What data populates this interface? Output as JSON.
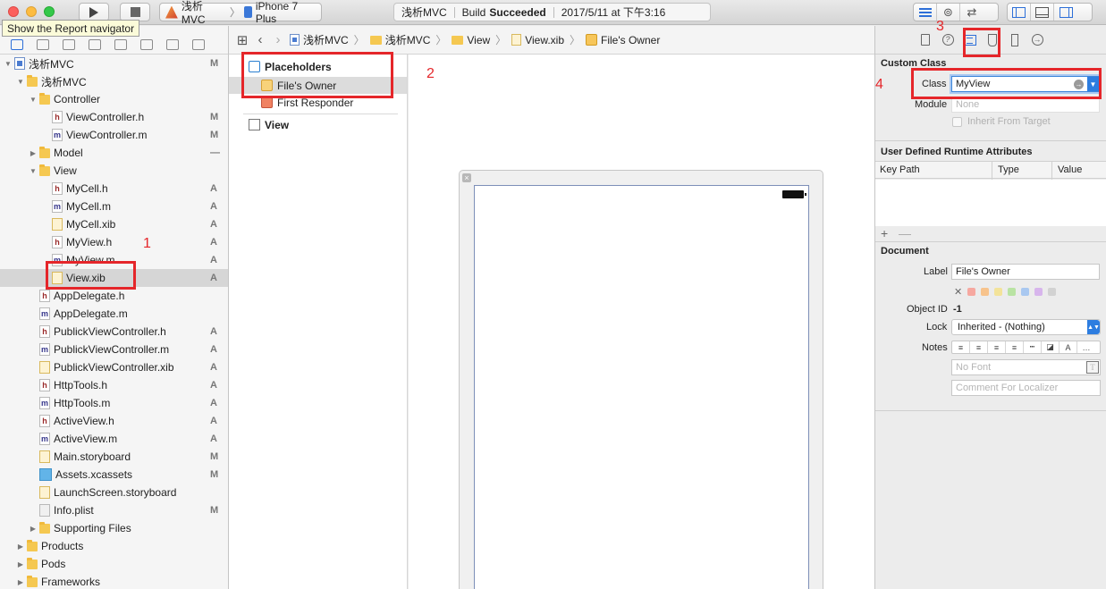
{
  "toolbar": {
    "scheme_app": "浅析MVC",
    "scheme_device": "iPhone 7 Plus",
    "activity_project": "浅析MVC",
    "activity_build_prefix": "Build",
    "activity_build_status": "Succeeded",
    "activity_time": "2017/5/11 at 下午3:16"
  },
  "tooltip": "Show the Report navigator",
  "navigator": {
    "rows": [
      {
        "name": "浅析MVC",
        "badge": "M",
        "kind": "proj",
        "depth": 0,
        "disclosure": "▼"
      },
      {
        "name": "浅析MVC",
        "badge": "",
        "kind": "folder",
        "depth": 1,
        "disclosure": "▼"
      },
      {
        "name": "Controller",
        "badge": "",
        "kind": "folder",
        "depth": 2,
        "disclosure": "▼"
      },
      {
        "name": "ViewController.h",
        "badge": "M",
        "kind": "h",
        "depth": 3,
        "disclosure": ""
      },
      {
        "name": "ViewController.m",
        "badge": "M",
        "kind": "m",
        "depth": 3,
        "disclosure": ""
      },
      {
        "name": "Model",
        "badge": "—",
        "kind": "folder",
        "depth": 2,
        "disclosure": "▶"
      },
      {
        "name": "View",
        "badge": "",
        "kind": "folder",
        "depth": 2,
        "disclosure": "▼"
      },
      {
        "name": "MyCell.h",
        "badge": "A",
        "kind": "h",
        "depth": 3,
        "disclosure": ""
      },
      {
        "name": "MyCell.m",
        "badge": "A",
        "kind": "m",
        "depth": 3,
        "disclosure": ""
      },
      {
        "name": "MyCell.xib",
        "badge": "A",
        "kind": "xib",
        "depth": 3,
        "disclosure": ""
      },
      {
        "name": "MyView.h",
        "badge": "A",
        "kind": "h",
        "depth": 3,
        "disclosure": ""
      },
      {
        "name": "MyView.m",
        "badge": "A",
        "kind": "m",
        "depth": 3,
        "disclosure": ""
      },
      {
        "name": "View.xib",
        "badge": "A",
        "kind": "xib",
        "depth": 3,
        "disclosure": "",
        "selected": true
      },
      {
        "name": "AppDelegate.h",
        "badge": "",
        "kind": "h",
        "depth": 2,
        "disclosure": ""
      },
      {
        "name": "AppDelegate.m",
        "badge": "",
        "kind": "m",
        "depth": 2,
        "disclosure": ""
      },
      {
        "name": "PublickViewController.h",
        "badge": "A",
        "kind": "h",
        "depth": 2,
        "disclosure": ""
      },
      {
        "name": "PublickViewController.m",
        "badge": "A",
        "kind": "m",
        "depth": 2,
        "disclosure": ""
      },
      {
        "name": "PublickViewController.xib",
        "badge": "A",
        "kind": "xib",
        "depth": 2,
        "disclosure": ""
      },
      {
        "name": "HttpTools.h",
        "badge": "A",
        "kind": "h",
        "depth": 2,
        "disclosure": ""
      },
      {
        "name": "HttpTools.m",
        "badge": "A",
        "kind": "m",
        "depth": 2,
        "disclosure": ""
      },
      {
        "name": "ActiveView.h",
        "badge": "A",
        "kind": "h",
        "depth": 2,
        "disclosure": ""
      },
      {
        "name": "ActiveView.m",
        "badge": "A",
        "kind": "m",
        "depth": 2,
        "disclosure": ""
      },
      {
        "name": "Main.storyboard",
        "badge": "M",
        "kind": "sb",
        "depth": 2,
        "disclosure": ""
      },
      {
        "name": "Assets.xcassets",
        "badge": "M",
        "kind": "assets",
        "depth": 2,
        "disclosure": ""
      },
      {
        "name": "LaunchScreen.storyboard",
        "badge": "",
        "kind": "sb",
        "depth": 2,
        "disclosure": ""
      },
      {
        "name": "Info.plist",
        "badge": "M",
        "kind": "plist",
        "depth": 2,
        "disclosure": ""
      },
      {
        "name": "Supporting Files",
        "badge": "",
        "kind": "folder",
        "depth": 2,
        "disclosure": "▶"
      },
      {
        "name": "Products",
        "badge": "",
        "kind": "folder",
        "depth": 1,
        "disclosure": "▶"
      },
      {
        "name": "Pods",
        "badge": "",
        "kind": "folder",
        "depth": 1,
        "disclosure": "▶"
      },
      {
        "name": "Frameworks",
        "badge": "",
        "kind": "folder",
        "depth": 1,
        "disclosure": "▶"
      }
    ]
  },
  "jumpbar": {
    "crumbs": [
      "浅析MVC",
      "浅析MVC",
      "View",
      "View.xib",
      "File's Owner"
    ]
  },
  "outline": {
    "placeholders": "Placeholders",
    "files_owner": "File's Owner",
    "first_responder": "First Responder",
    "view": "View"
  },
  "inspector": {
    "custom_class_title": "Custom Class",
    "class_label": "Class",
    "class_value": "MyView",
    "module_label": "Module",
    "module_placeholder": "None",
    "inherit_label": "Inherit From Target",
    "udra_title": "User Defined Runtime Attributes",
    "col_key_path": "Key Path",
    "col_type": "Type",
    "col_value": "Value",
    "add_symbol": "+",
    "remove_symbol": "—",
    "document_title": "Document",
    "doc_label_label": "Label",
    "doc_label_value": "File's Owner",
    "object_id_label": "Object ID",
    "object_id_value": "-1",
    "lock_label": "Lock",
    "lock_value": "Inherited - (Nothing)",
    "notes_label": "Notes",
    "font_placeholder": "No Font",
    "comment_placeholder": "Comment For Localizer",
    "swatch_colors": [
      "#f6a8a0",
      "#f7c38c",
      "#f3e39a",
      "#b9e3a3",
      "#a9c8f0",
      "#d7b5ec",
      "#d2d2d2"
    ]
  },
  "annotations": [
    "1",
    "2",
    "3",
    "4"
  ]
}
